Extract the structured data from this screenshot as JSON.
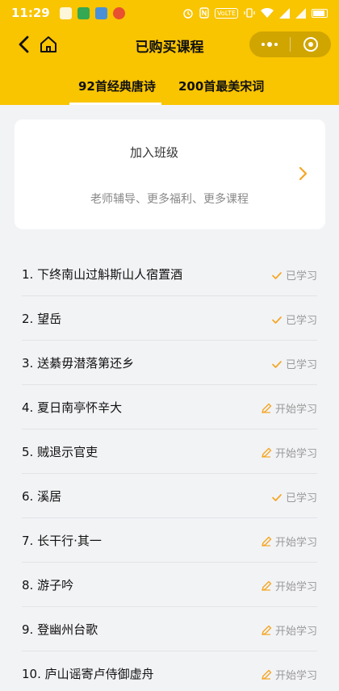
{
  "status_bar": {
    "time": "11:29",
    "network_badge": "VoLTE"
  },
  "nav": {
    "title": "已购买课程"
  },
  "tabs": [
    {
      "label": "92首经典唐诗",
      "active": true
    },
    {
      "label": "200首最美宋词",
      "active": false
    }
  ],
  "class_card": {
    "title": "加入班级",
    "subtitle": "老师辅导、更多福利、更多课程"
  },
  "courses": [
    {
      "title": "1. 下终南山过斛斯山人宿置酒",
      "status": "已学习",
      "status_icon": "check-icon"
    },
    {
      "title": "2. 望岳",
      "status": "已学习",
      "status_icon": "check-icon"
    },
    {
      "title": "3. 送綦毋潜落第还乡",
      "status": "已学习",
      "status_icon": "check-icon"
    },
    {
      "title": "4. 夏日南亭怀辛大",
      "status": "开始学习",
      "status_icon": "pencil-icon"
    },
    {
      "title": "5. 贼退示官吏",
      "status": "开始学习",
      "status_icon": "pencil-icon"
    },
    {
      "title": "6. 溪居",
      "status": "已学习",
      "status_icon": "check-icon"
    },
    {
      "title": "7. 长干行·其一",
      "status": "开始学习",
      "status_icon": "pencil-icon"
    },
    {
      "title": "8. 游子吟",
      "status": "开始学习",
      "status_icon": "pencil-icon"
    },
    {
      "title": "9. 登幽州台歌",
      "status": "开始学习",
      "status_icon": "pencil-icon"
    },
    {
      "title": "10. 庐山谣寄卢侍御虚舟",
      "status": "开始学习",
      "status_icon": "pencil-icon"
    }
  ],
  "colors": {
    "brand_yellow": "#f9c400",
    "accent_orange": "#f5a623",
    "background": "#f2f3f5"
  }
}
